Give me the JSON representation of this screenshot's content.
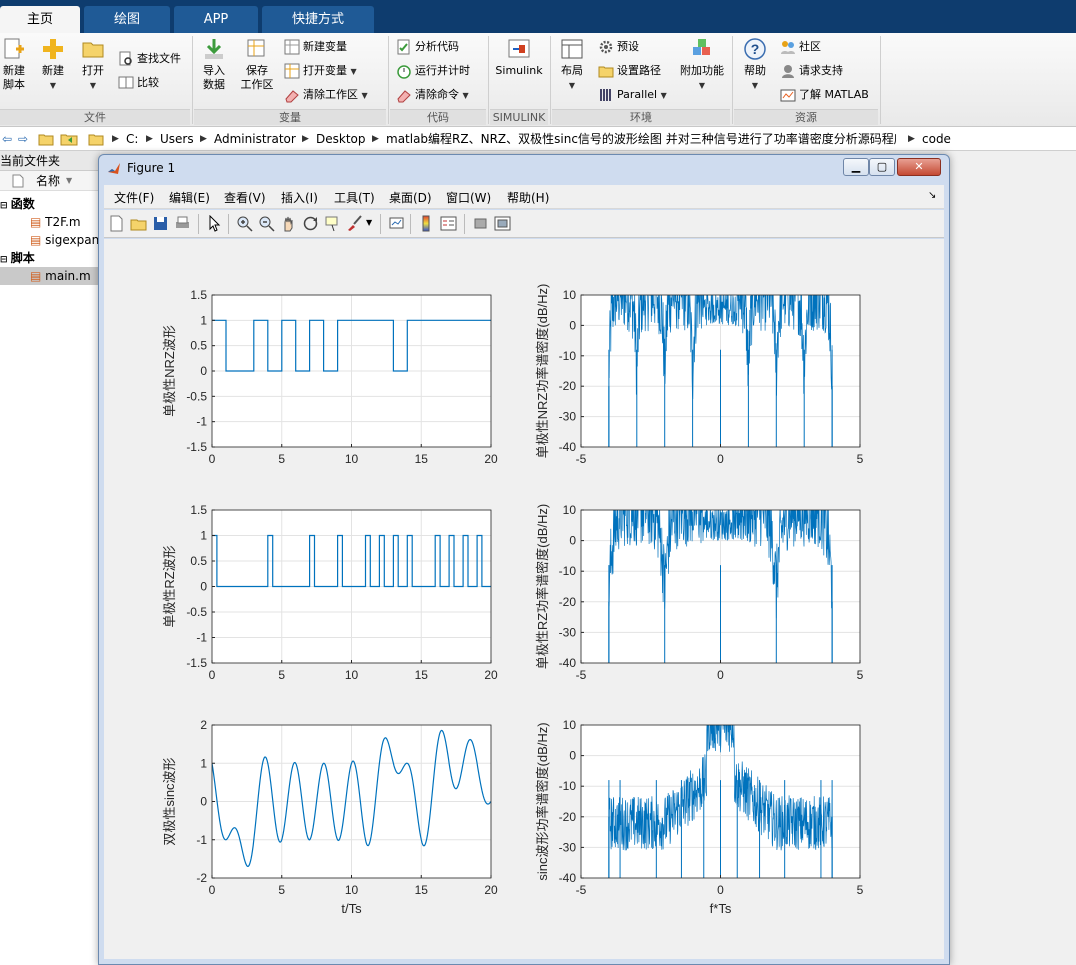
{
  "ribbon": {
    "tabs": [
      "主页",
      "绘图",
      "APP",
      "快捷方式"
    ],
    "groups": {
      "file": "文件",
      "variable": "变量",
      "code": "代码",
      "simulink": "SIMULINK",
      "env": "环境",
      "resources": "资源"
    },
    "buttons": {
      "new_script": "新建\n脚本",
      "new": "新建",
      "open": "打开",
      "find_files": "查找文件",
      "compare": "比较",
      "import_data": "导入\n数据",
      "save_workspace": "保存\n工作区",
      "new_variable": "新建变量",
      "open_variable": "打开变量",
      "clear_workspace": "清除工作区",
      "analyze_code": "分析代码",
      "run_and_time": "运行并计时",
      "clear_commands": "清除命令",
      "simulink": "Simulink",
      "layout": "布局",
      "preferences": "预设",
      "set_path": "设置路径",
      "parallel": "Parallel",
      "add_ons": "附加功能",
      "help": "帮助",
      "community": "社区",
      "request_support": "请求支持",
      "learn_matlab": "了解 MATLAB"
    }
  },
  "address": {
    "crumbs": [
      "C:",
      "Users",
      "Administrator",
      "Desktop",
      "matlab编程RZ、NRZ、双极性sinc信号的波形绘图 并对三种信号进行了功率谱密度分析源码程序",
      "code"
    ]
  },
  "file_browser": {
    "title": "当前文件夹",
    "column": "名称",
    "groups": [
      {
        "label": "函数",
        "items": [
          "T2F.m",
          "sigexpan"
        ]
      },
      {
        "label": "脚本",
        "items": [
          "main.m"
        ]
      }
    ]
  },
  "figure": {
    "title": "Figure 1",
    "menus": [
      "文件(F)",
      "编辑(E)",
      "查看(V)",
      "插入(I)",
      "工具(T)",
      "桌面(D)",
      "窗口(W)",
      "帮助(H)"
    ]
  },
  "chart_data": [
    {
      "type": "line",
      "panel": "nrz-wave",
      "ylabel": "单极性NRZ波形",
      "xlabel": "",
      "xlim": [
        0,
        20
      ],
      "ylim": [
        -1.5,
        1.5
      ],
      "xticks": [
        0,
        5,
        10,
        15,
        20
      ],
      "yticks": [
        -1.5,
        -1,
        -0.5,
        0,
        0.5,
        1,
        1.5
      ],
      "color": "#0072bd",
      "bits": [
        1,
        0,
        0,
        1,
        0,
        1,
        0,
        1,
        0,
        1,
        1,
        1,
        1,
        0,
        1,
        1,
        1,
        1,
        1,
        1
      ]
    },
    {
      "type": "line",
      "panel": "nrz-psd",
      "ylabel": "单极性NRZ功率谱密度(dB/Hz)",
      "xlabel": "",
      "xlim": [
        -5,
        5
      ],
      "ylim": [
        -40,
        10
      ],
      "xticks": [
        -5,
        0,
        5
      ],
      "yticks": [
        -40,
        -30,
        -20,
        -10,
        0,
        10
      ],
      "color": "#0072bd",
      "nulls": [
        -4,
        -3,
        -2,
        -1,
        0,
        1,
        2,
        3,
        4
      ]
    },
    {
      "type": "line",
      "panel": "rz-wave",
      "ylabel": "单极性RZ波形",
      "xlabel": "",
      "xlim": [
        0,
        20
      ],
      "ylim": [
        -1.5,
        1.5
      ],
      "xticks": [
        0,
        5,
        10,
        15,
        20
      ],
      "yticks": [
        -1.5,
        -1,
        -0.5,
        0,
        0.5,
        1,
        1.5
      ],
      "color": "#0072bd",
      "bits": [
        1,
        0,
        0,
        0,
        1,
        0,
        0,
        1,
        0,
        1,
        0,
        1,
        1,
        1,
        1,
        0,
        1,
        1,
        1,
        1
      ]
    },
    {
      "type": "line",
      "panel": "rz-psd",
      "ylabel": "单极性RZ功率谱密度(dB/Hz)",
      "xlabel": "",
      "xlim": [
        -5,
        5
      ],
      "ylim": [
        -40,
        10
      ],
      "xticks": [
        -5,
        0,
        5
      ],
      "yticks": [
        -40,
        -30,
        -20,
        -10,
        0,
        10
      ],
      "color": "#0072bd",
      "nulls": [
        -4,
        -2,
        0,
        2,
        4
      ]
    },
    {
      "type": "line",
      "panel": "sinc-wave",
      "ylabel": "双极性sinc波形",
      "xlabel": "t/Ts",
      "xlim": [
        0,
        20
      ],
      "ylim": [
        -2,
        2
      ],
      "xticks": [
        0,
        5,
        10,
        15,
        20
      ],
      "yticks": [
        -2,
        -1,
        0,
        1,
        2
      ],
      "color": "#0072bd",
      "symbols": [
        1,
        -1,
        -1,
        -1,
        1,
        -1,
        1,
        -1,
        1,
        -1,
        1,
        -1,
        1,
        1,
        1,
        -1,
        1,
        1,
        1,
        1
      ]
    },
    {
      "type": "line",
      "panel": "sinc-psd",
      "ylabel": "sinc波形功率谱密度(dB/Hz)",
      "xlabel": "f*Ts",
      "xlim": [
        -5,
        5
      ],
      "ylim": [
        -40,
        10
      ],
      "xticks": [
        -5,
        0,
        5
      ],
      "yticks": [
        -40,
        -30,
        -20,
        -10,
        0,
        10
      ],
      "color": "#0072bd",
      "band": [
        -0.5,
        0.5
      ]
    }
  ]
}
